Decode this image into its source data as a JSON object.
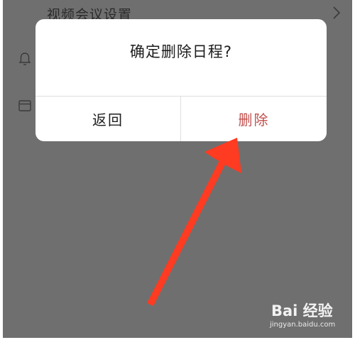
{
  "background_page": {
    "row_title": "视频会议设置",
    "chevron_icon": "chevron-right-icon",
    "bell_icon": "bell-icon",
    "card_icon": "calendar-card-icon"
  },
  "dialog": {
    "title": "确定删除日程?",
    "back_label": "返回",
    "delete_label": "删除",
    "delete_color": "#c0504d"
  },
  "annotation": {
    "arrow_color": "#ff3b22"
  },
  "watermark": {
    "logo_text": "Bai 经验",
    "url": "jingyan.baidu.com"
  }
}
